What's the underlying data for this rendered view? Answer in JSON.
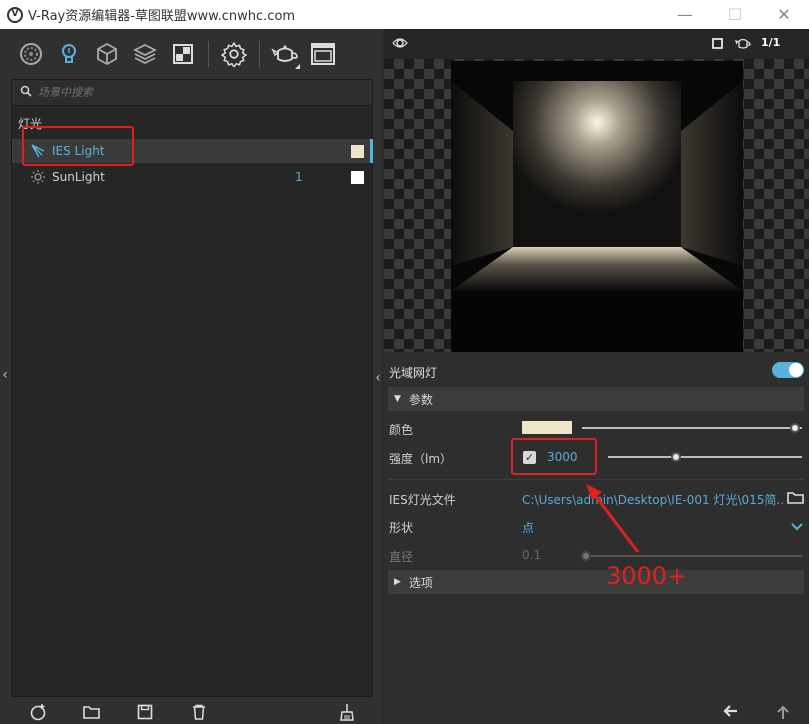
{
  "window": {
    "title": "V-Ray资源编辑器-草图联盟www.cnwhc.com",
    "logo_letter": "V",
    "minimize": "—",
    "maximize": "☐",
    "close": "✕"
  },
  "toolbar": {
    "icons": [
      "materials-icon",
      "lights-icon",
      "geometry-icon",
      "layers-icon",
      "render-elements-icon",
      "settings-icon",
      "render-teapot-icon",
      "frame-buffer-icon"
    ]
  },
  "outliner": {
    "search_placeholder": "场景中搜索",
    "category": "灯光",
    "items": [
      {
        "name": "IES Light",
        "count": "",
        "swatch": "#efe3c8",
        "selected": true
      },
      {
        "name": "SunLight",
        "count": "1",
        "swatch": "#ffffff",
        "selected": false
      }
    ]
  },
  "preview": {
    "scale_label": "1/1"
  },
  "properties": {
    "header": "光域网灯",
    "enabled": true,
    "section_params": "参数",
    "color_label": "颜色",
    "color_swatch": "#efe3c8",
    "color_level": 0.97,
    "intensity_label": "强度（lm）",
    "intensity_checked": true,
    "intensity_value": "3000",
    "intensity_level": 0.35,
    "ies_file_label": "IES灯光文件",
    "ies_file_path": "C:\\Users\\admin\\Desktop\\IE-001 灯光\\015简...",
    "shape_label": "形状",
    "shape_value": "点",
    "diameter_label": "直径",
    "diameter_value": "0.1",
    "diameter_level": 0.0,
    "section_options": "选项"
  },
  "annotation": {
    "text": "3000+",
    "color": "#e02020"
  },
  "colors": {
    "accent": "#5ab2dc",
    "panel": "#303030"
  }
}
